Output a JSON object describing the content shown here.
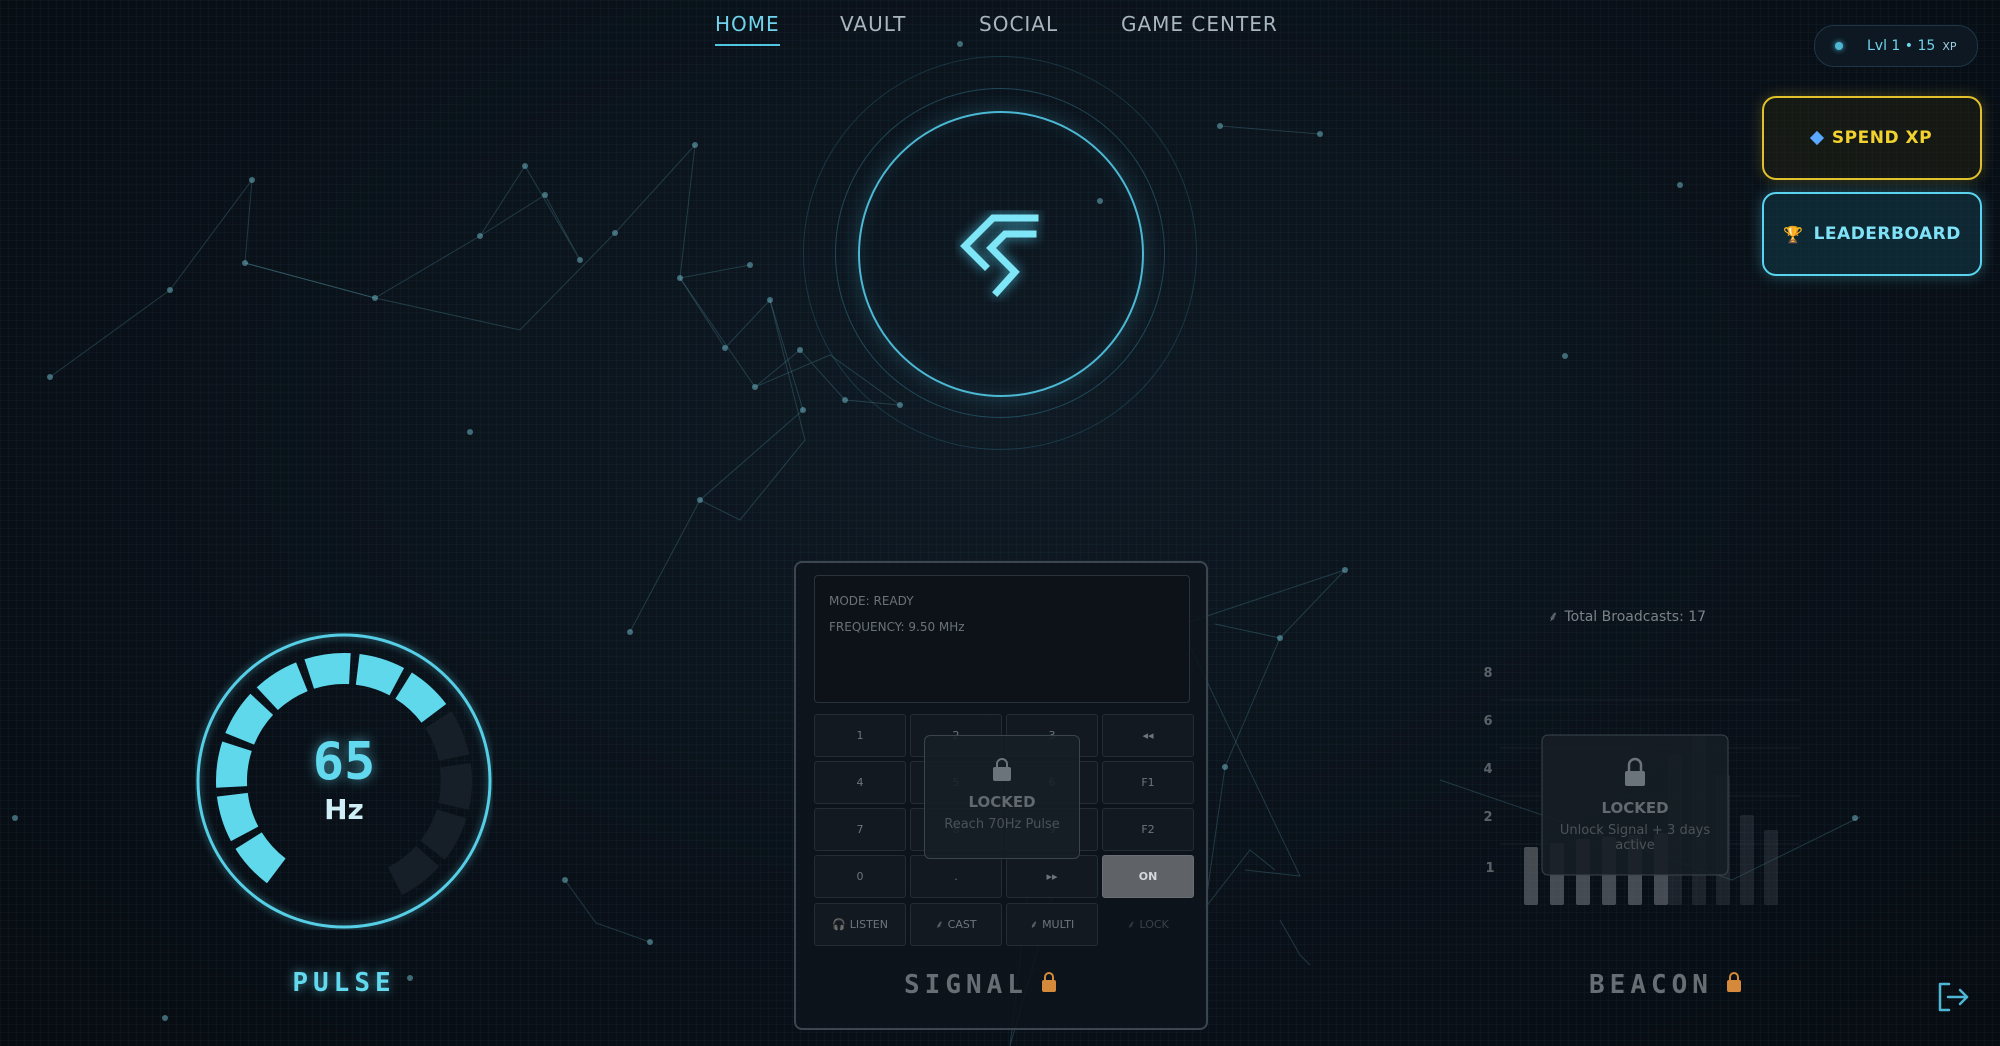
{
  "nav": {
    "items": [
      {
        "label": "HOME",
        "active": true
      },
      {
        "label": "VAULT",
        "active": false
      },
      {
        "label": "SOCIAL",
        "active": false
      },
      {
        "label": "GAME CENTER",
        "active": false
      }
    ]
  },
  "level": {
    "text": "Lvl 1 • 15",
    "unit": "XP"
  },
  "actions": {
    "spend_xp": "SPEND XP",
    "leaderboard": "LEADERBOARD"
  },
  "brand": {
    "icon": "brand-logo-icon",
    "accent_color": "#4fc7e3"
  },
  "pulse": {
    "value": "65",
    "unit": "Hz",
    "title": "PULSE",
    "filled_segments": 8,
    "total_segments": 12
  },
  "signal": {
    "title": "SIGNAL",
    "screen": {
      "mode": "MODE: READY",
      "frequency": "FREQUENCY: 9.50 MHz"
    },
    "keys": [
      [
        "1",
        "2",
        "3",
        "◂◂"
      ],
      [
        "4",
        "5",
        "6",
        "F1"
      ],
      [
        "7",
        "8",
        "9",
        "F2"
      ],
      [
        "0",
        ".",
        "▸▸",
        "ON"
      ]
    ],
    "modes": [
      "LISTEN",
      "CAST",
      "MULTI",
      "LOCK"
    ],
    "locked": {
      "title": "LOCKED",
      "requirement": "Reach 70Hz Pulse"
    }
  },
  "beacon": {
    "title": "BEACON",
    "total_broadcasts": "Total Broadcasts: 17",
    "y_ticks": [
      "8",
      "6",
      "4",
      "2",
      "1"
    ],
    "locked": {
      "title": "LOCKED",
      "requirement": "Unlock Signal + 3 days active"
    }
  },
  "colors": {
    "accent": "#4fc7e3",
    "gold": "#e1c22a",
    "lock": "#d48a3a"
  }
}
